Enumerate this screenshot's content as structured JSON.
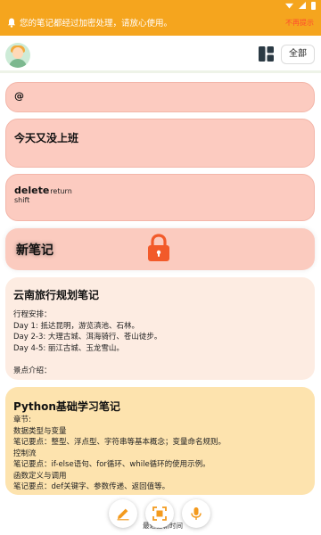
{
  "status_bar": {
    "icons": [
      "wifi-icon",
      "signal-icon",
      "battery-icon"
    ]
  },
  "banner": {
    "text": "您的笔记都经过加密处理，请放心使用。",
    "close_label": "不再提示",
    "icon": "bell-icon",
    "bg_color": "#f5a51e"
  },
  "header": {
    "avatar": "avatar",
    "layout_icon": "layout-toggle-icon",
    "filter_label": "全部"
  },
  "notes": [
    {
      "title": "@",
      "body": ""
    },
    {
      "title": "今天又没上班",
      "body": ""
    },
    {
      "title": "delete",
      "title_suffix": "return",
      "body": "shift"
    },
    {
      "title": "新笔记",
      "locked": true
    },
    {
      "title": "云南旅行规划笔记",
      "body": "行程安排：\nDay 1: 抵达昆明，游览滇池、石林。\nDay 2-3: 大理古城、洱海骑行、苍山徒步。\nDay 4-5: 丽江古城、玉龙雪山。\n\n景点介绍："
    },
    {
      "title": "Python基础学习笔记",
      "body": "章节:\n数据类型与变量\n笔记要点：整型、浮点型、字符串等基本概念；变量命名规则。\n控制流\n笔记要点：if-else语句、for循环、while循环的使用示例。\n函数定义与调用\n笔记要点：def关键字、参数传递、返回值等。"
    }
  ],
  "bottom": {
    "hint": "最近更新时间",
    "buttons": [
      "pencil-icon",
      "scan-icon",
      "mic-icon"
    ],
    "accent": "#f39a1d"
  }
}
